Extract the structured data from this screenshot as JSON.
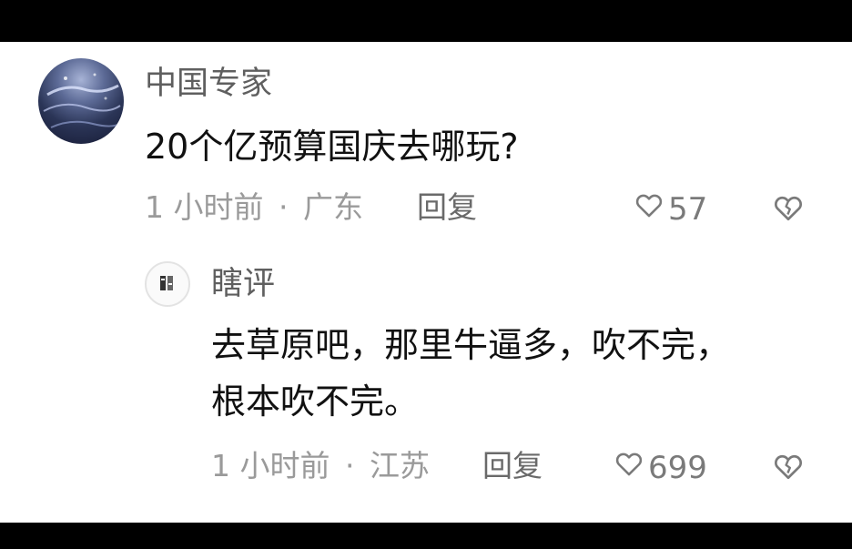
{
  "comment": {
    "author": "中国专家",
    "text": "20个亿预算国庆去哪玩?",
    "time": "1 小时前",
    "separator": "·",
    "location": "广东",
    "reply_label": "回复",
    "likes": "57"
  },
  "reply": {
    "author": "瞎评",
    "text_line1": "去草原吧，那里牛逼多，吹不完，",
    "text_line2": "根本吹不完。",
    "time": "1 小时前",
    "separator": "·",
    "location": "江苏",
    "reply_label": "回复",
    "likes": "699"
  },
  "icons": {
    "like": "heart-outline-icon",
    "dislike": "broken-heart-icon"
  }
}
